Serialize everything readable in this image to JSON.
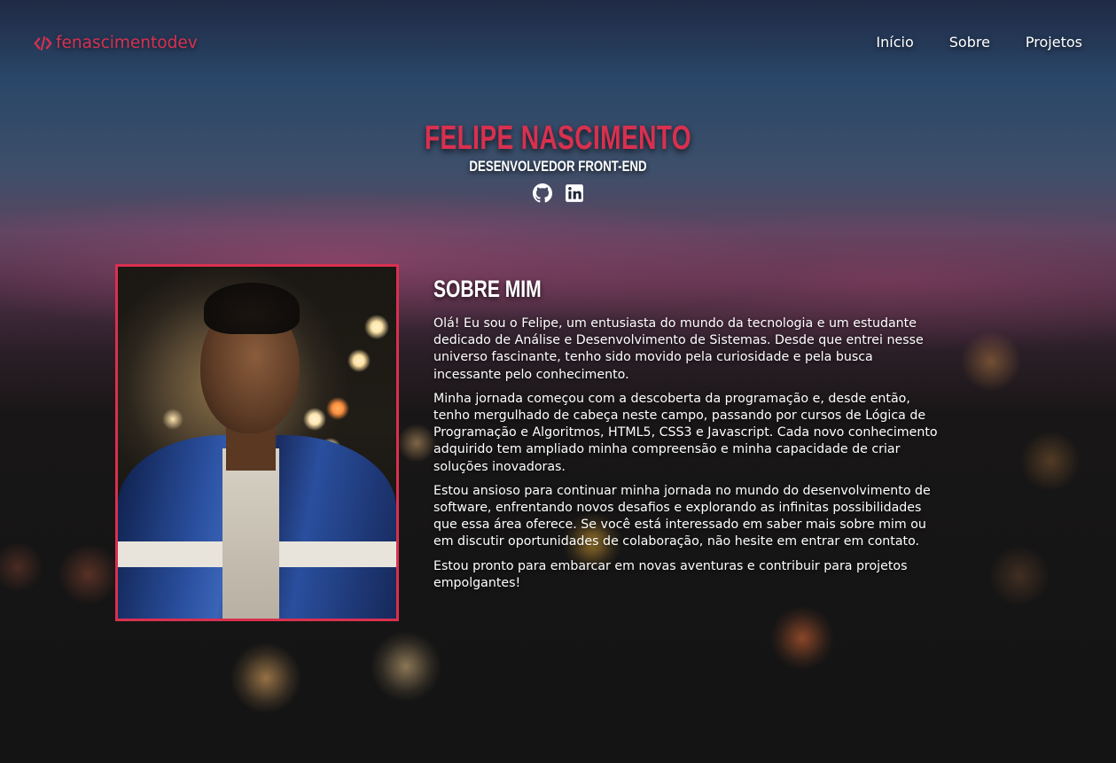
{
  "header": {
    "logo_text": "fenascimentodev",
    "logo_icon": "code-icon",
    "nav": [
      {
        "label": "Início"
      },
      {
        "label": "Sobre"
      },
      {
        "label": "Projetos"
      }
    ]
  },
  "hero": {
    "name": "FELIPE NASCIMENTO",
    "role": "DESENVOLVEDOR FRONT-END",
    "social_icons": [
      "github-icon",
      "linkedin-icon"
    ]
  },
  "about": {
    "title": "SOBRE MIM",
    "paragraphs": [
      "Olá! Eu sou o Felipe, um entusiasta do mundo da tecnologia e um estudante dedicado de Análise e Desenvolvimento de Sistemas. Desde que entrei nesse universo fascinante, tenho sido movido pela curiosidade e pela busca incessante pelo conhecimento.",
      "Minha jornada começou com a descoberta da programação e, desde então, tenho mergulhado de cabeça neste campo, passando por cursos de Lógica de Programação e Algoritmos, HTML5, CSS3 e Javascript. Cada novo conhecimento adquirido tem ampliado minha compreensão e minha capacidade de criar soluções inovadoras.",
      "Estou ansioso para continuar minha jornada no mundo do desenvolvimento de software, enfrentando novos desafios e explorando as infinitas possibilidades que essa área oferece. Se você está interessado em saber mais sobre mim ou em discutir oportunidades de colaboração, não hesite em entrar em contato.",
      "Estou pronto para embarcar em novas aventuras e contribuir para projetos empolgantes!"
    ]
  },
  "colors": {
    "accent": "#d9304f",
    "text": "#ffffff"
  }
}
